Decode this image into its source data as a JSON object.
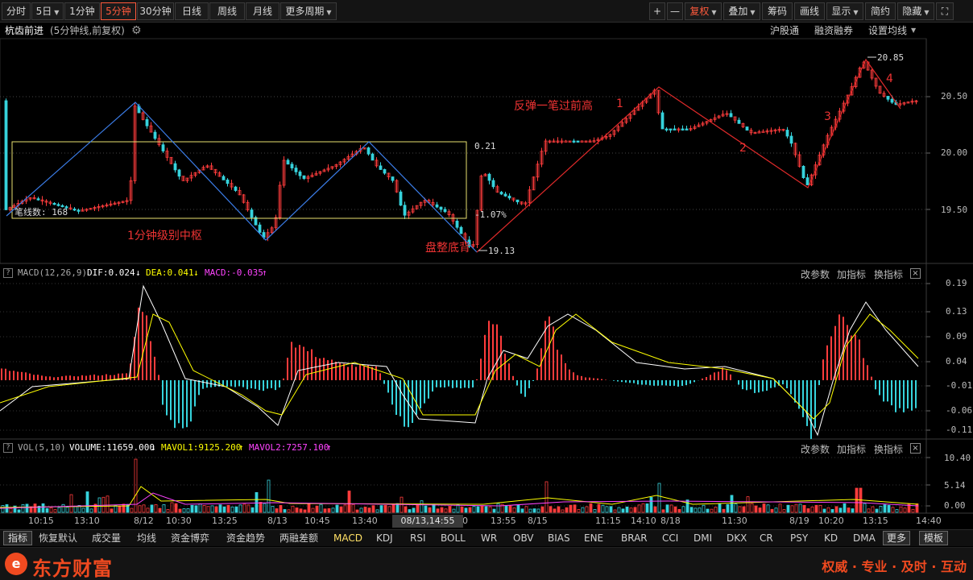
{
  "toolbar": {
    "left": [
      {
        "label": "分时",
        "caret": false,
        "active": false
      },
      {
        "label": "5日",
        "caret": true,
        "active": false
      },
      {
        "label": "1分钟",
        "caret": false,
        "active": false
      },
      {
        "label": "5分钟",
        "caret": false,
        "active": true
      },
      {
        "label": "30分钟",
        "caret": false,
        "active": false
      },
      {
        "label": "日线",
        "caret": false,
        "active": false
      },
      {
        "label": "周线",
        "caret": false,
        "active": false
      },
      {
        "label": "月线",
        "caret": false,
        "active": false
      },
      {
        "label": "更多周期",
        "caret": true,
        "active": false
      }
    ],
    "right": [
      {
        "label": "+",
        "caret": false,
        "red": false
      },
      {
        "label": "—",
        "caret": false,
        "red": false
      },
      {
        "label": "复权",
        "caret": true,
        "red": true
      },
      {
        "label": "叠加",
        "caret": true,
        "red": false
      },
      {
        "label": "筹码",
        "caret": false,
        "red": false
      },
      {
        "label": "画线",
        "caret": false,
        "red": false
      },
      {
        "label": "显示",
        "caret": true,
        "red": false
      },
      {
        "label": "简约",
        "caret": false,
        "red": false
      },
      {
        "label": "隐藏",
        "caret": true,
        "red": false
      },
      {
        "label": "⛶",
        "caret": false,
        "red": false
      }
    ]
  },
  "stock": {
    "name": "杭齿前进",
    "mode": "(5分钟线,前复权)"
  },
  "header_links": {
    "hgt": "沪股通",
    "rzrq": "融资融券",
    "ma": "设置均线"
  },
  "macd": {
    "name": "MACD(12,26,9)",
    "dif": "DIF:0.024",
    "dea": "DEA:0.041",
    "macd": "MACD:-0.035",
    "dif_arrow": "↓",
    "dea_arrow": "↓",
    "macd_arrow": "↑"
  },
  "vol": {
    "name": "VOL(5,10)",
    "volume": "VOLUME:11659.000",
    "mavol1": "MAVOL1:9125.200",
    "mavol2": "MAVOL2:7257.100",
    "volume_arrow": "↓",
    "mavol1_arrow": "↑",
    "mavol2_arrow": "↑"
  },
  "pane_actions": {
    "params": "改参数",
    "add": "加指标",
    "change": "换指标"
  },
  "help": "?",
  "close": "×",
  "y_price": [
    "20.50",
    "20.00",
    "19.50"
  ],
  "y_macd": [
    "0.19",
    "0.13",
    "0.09",
    "0.04",
    "-0.01",
    "-0.06",
    "-0.11"
  ],
  "y_vol": [
    "10.40",
    "5.14",
    "0.00"
  ],
  "x_labels": [
    "10:15",
    "13:10",
    "8/12",
    "10:30",
    "13:25",
    "8/13",
    "10:45",
    "13:40",
    "0",
    "13:55",
    "8/15",
    "11:15",
    "14:10",
    "8/18",
    "11:30",
    "8/19",
    "10:20",
    "13:15",
    "14:40"
  ],
  "x_cursor": "08/13,14:55",
  "annotations": {
    "zhongshu": "1分钟级别中枢",
    "panzheng": "盘整底背",
    "fantan": "反弹一笔过前高",
    "n1": "1",
    "n2": "2",
    "n3": "3",
    "n4": "4",
    "box_high": "0.21",
    "box_low": "-1.07%",
    "low_price": "19.13",
    "high_price": "20.85",
    "stroke_count": "笔线数: 168"
  },
  "tabs": [
    "指标",
    "恢复默认",
    "成交量",
    "均线",
    "资金博弈",
    "资金趋势",
    "两融差额",
    "MACD",
    "KDJ",
    "RSI",
    "BOLL",
    "WR",
    "OBV",
    "BIAS",
    "ENE",
    "BRAR",
    "CCI",
    "DMI",
    "DKX",
    "CR",
    "PSY",
    "KD",
    "DMA"
  ],
  "tab_more": "更多",
  "tab_template": "模板",
  "active_tab": "MACD",
  "footer": {
    "logo": "东方财富",
    "slogan": "权威 · 专业 · 及时 · 互动"
  },
  "colors": {
    "up": "#ff3c3c",
    "down": "#36d3dc",
    "dif": "#ffffff",
    "dea": "#ffff00",
    "accent": "#ff5a3c",
    "magenta": "#ff44ff"
  }
}
